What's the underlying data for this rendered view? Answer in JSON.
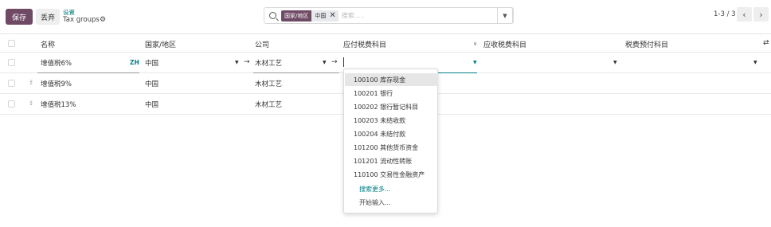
{
  "control_panel": {
    "save_label": "保存",
    "discard_label": "丢弃",
    "breadcrumb_parent": "设置",
    "breadcrumb_current": "Tax groups",
    "gear_icon": "gear-icon",
    "search": {
      "facet_label": "国家/地区",
      "facet_value": "中国",
      "placeholder": "搜索....."
    },
    "pager": "1-3 / 3"
  },
  "columns": {
    "name": "名称",
    "country": "国家/地区",
    "company": "公司",
    "payable": "应付税费科目",
    "receivable": "应收税费科目",
    "advance": "税费预付科目"
  },
  "rows": [
    {
      "name": "增值税6%",
      "country": "中国",
      "company": "木材工艺",
      "lang": "ZH"
    },
    {
      "name": "增值税9%",
      "country": "中国",
      "company": "木材工艺"
    },
    {
      "name": "增值税13%",
      "country": "中国",
      "company": "木材工艺"
    }
  ],
  "dropdown": {
    "items": [
      "100100 库存现金",
      "100201 银行",
      "100202 银行暂记科目",
      "100203 未结收款",
      "100204 未结付款",
      "101200 其他货币资金",
      "101201 流动性转账",
      "110100 交易性金融资产"
    ],
    "search_more": "搜索更多...",
    "start_typing": "开始输入..."
  },
  "colors": {
    "primary": "#6f4a65",
    "link": "#017e84"
  }
}
